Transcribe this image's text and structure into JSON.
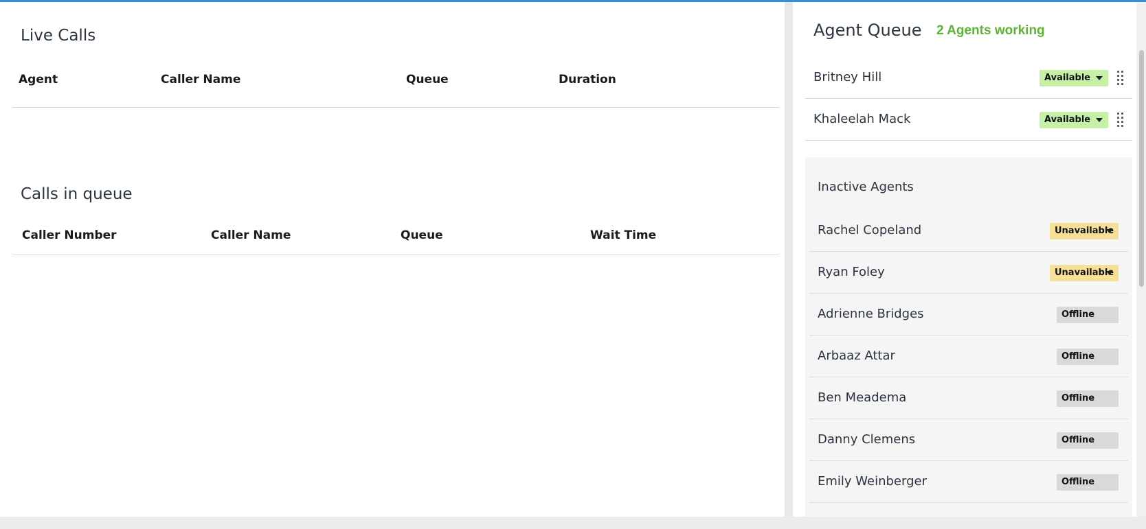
{
  "live_calls": {
    "title": "Live Calls",
    "columns": [
      "Agent",
      "Caller Name",
      "Queue",
      "Duration"
    ]
  },
  "calls_in_queue": {
    "title": "Calls in queue",
    "columns": [
      "Caller Number",
      "Caller Name",
      "Queue",
      "Wait Time"
    ]
  },
  "agent_queue": {
    "title": "Agent Queue",
    "working_label": "2 Agents working",
    "active_agents": [
      {
        "name": "Britney Hill",
        "status": "Available"
      },
      {
        "name": "Khaleelah Mack",
        "status": "Available"
      }
    ],
    "inactive_title": "Inactive Agents",
    "inactive_agents": [
      {
        "name": "Rachel Copeland",
        "status": "Unavailable"
      },
      {
        "name": "Ryan Foley",
        "status": "Unavailable"
      },
      {
        "name": "Adrienne Bridges",
        "status": "Offline"
      },
      {
        "name": "Arbaaz Attar",
        "status": "Offline"
      },
      {
        "name": "Ben Meadema",
        "status": "Offline"
      },
      {
        "name": "Danny Clemens",
        "status": "Offline"
      },
      {
        "name": "Emily Weinberger",
        "status": "Offline"
      }
    ]
  },
  "colors": {
    "accent_bar": "#2f8fd8",
    "working_green": "#5cb531",
    "available_bg": "#c6f0a6",
    "unavailable_bg": "#f6df97",
    "offline_bg": "#d9d9d9"
  }
}
